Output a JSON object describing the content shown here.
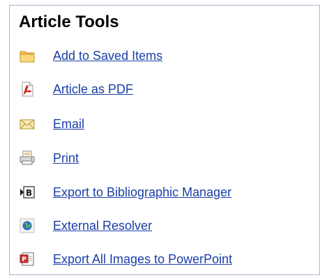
{
  "panel": {
    "title": "Article Tools",
    "tools": [
      {
        "label": "Add to Saved Items",
        "icon": "folder-icon"
      },
      {
        "label": "Article as PDF",
        "icon": "pdf-icon"
      },
      {
        "label": "Email",
        "icon": "envelope-icon"
      },
      {
        "label": "Print",
        "icon": "printer-icon"
      },
      {
        "label": "Export to Bibliographic Manager",
        "icon": "bibliography-export-icon"
      },
      {
        "label": "External Resolver",
        "icon": "globe-icon"
      },
      {
        "label": "Export All Images to PowerPoint",
        "icon": "powerpoint-icon"
      }
    ]
  }
}
